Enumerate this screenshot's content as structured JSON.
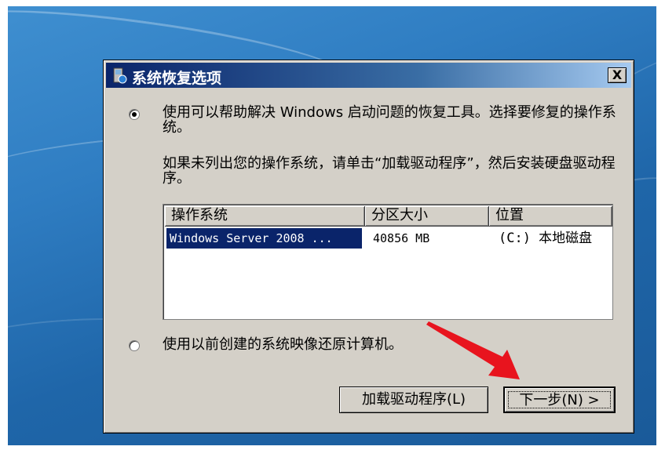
{
  "dialog": {
    "title": "系统恢复选项",
    "close_label": "X"
  },
  "options": {
    "option1_text": "使用可以帮助解决 Windows 启动问题的恢复工具。选择要修复的操作系统。",
    "option1_selected": true,
    "option2_text": "使用以前创建的系统映像还原计算机。",
    "option2_selected": false,
    "hint_text": "如果未列出您的操作系统，请单击“加载驱动程序”，然后安装硬盘驱动程序。"
  },
  "os_list": {
    "columns": [
      "操作系统",
      "分区大小",
      "位置"
    ],
    "rows": [
      {
        "os": "Windows Server 2008 ...",
        "size": "40856 MB",
        "location": "(C:) 本地磁盘",
        "selected": true
      }
    ]
  },
  "buttons": {
    "load_driver": "加载驱动程序(L)",
    "next": "下一步(N) >"
  },
  "colors": {
    "title_bar": "#0a246a",
    "selection": "#0a246a",
    "dialog_bg": "#d4d0c8",
    "arrow": "#e8141e"
  }
}
